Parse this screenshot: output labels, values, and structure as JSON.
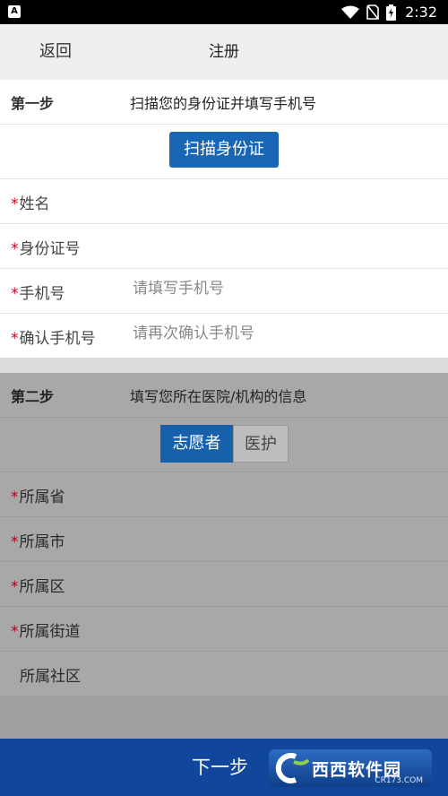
{
  "status_bar": {
    "time": "2:32",
    "app_icon_letter": "A"
  },
  "header": {
    "back_label": "返回",
    "title": "注册"
  },
  "step1": {
    "label": "第一步",
    "description": "扫描您的身份证并填写手机号",
    "scan_button": "扫描身份证",
    "fields": [
      {
        "label": "姓名",
        "required": "*",
        "value": "",
        "placeholder": ""
      },
      {
        "label": "身份证号",
        "required": "*",
        "value": "",
        "placeholder": ""
      },
      {
        "label": "手机号",
        "required": "*",
        "value": "",
        "placeholder": "请填写手机号"
      },
      {
        "label": "确认手机号",
        "required": "*",
        "value": "",
        "placeholder": "请再次确认手机号"
      }
    ]
  },
  "step2": {
    "label": "第二步",
    "description": "填写您所在医院/机构的信息",
    "segments": {
      "volunteer": "志愿者",
      "medical": "医护",
      "selected": "志愿者"
    },
    "fields": [
      {
        "label": "所属省",
        "required": "*"
      },
      {
        "label": "所属市",
        "required": "*"
      },
      {
        "label": "所属区",
        "required": "*"
      },
      {
        "label": "所属街道",
        "required": "*"
      },
      {
        "label": "所属社区",
        "required": ""
      }
    ]
  },
  "footer": {
    "next_label": "下一步"
  },
  "watermark": {
    "text": "西西软件园",
    "sub": "CR173.COM"
  },
  "colors": {
    "primary": "#1966b7",
    "footer": "#10479c",
    "required": "#d0021b",
    "overlay": "#a8a8a8"
  }
}
